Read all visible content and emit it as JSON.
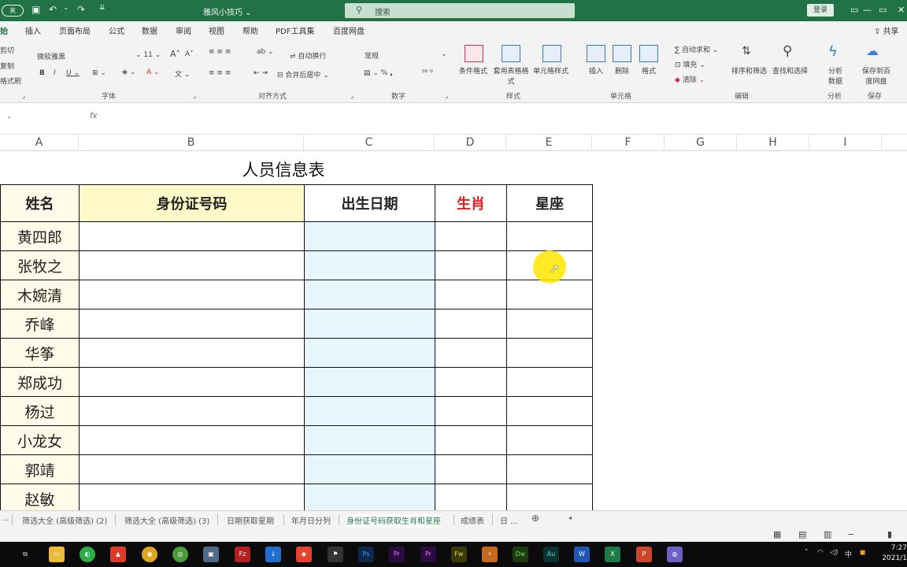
{
  "titlebar": {
    "autosave": "关",
    "title": "雅风小技巧 ⌄",
    "search_placeholder": "搜索",
    "login": "登录",
    "minimize": "—",
    "restore": "▭",
    "close": "✕"
  },
  "tabs": [
    "始",
    "插入",
    "页面布局",
    "公式",
    "数据",
    "审阅",
    "视图",
    "帮助",
    "PDF工具集",
    "百度网盘"
  ],
  "share": "共享",
  "ribbon": {
    "clipboard": [
      "剪切",
      "复制",
      "格式刷"
    ],
    "font_name": "微软雅黑",
    "font_size": "11",
    "font_group": "字体",
    "align_wrap": "自动换行",
    "align_merge": "合并后居中",
    "align_group": "对齐方式",
    "number_format": "常规",
    "number_group": "数字",
    "styles": [
      "条件格式",
      "套用表格格式",
      "单元格样式"
    ],
    "styles_group": "样式",
    "cells": [
      "插入",
      "删除",
      "格式"
    ],
    "cells_group": "单元格",
    "edit": [
      "自动求和",
      "填充",
      "清除"
    ],
    "sort": "排序和筛选",
    "find": "查找和选择",
    "edit_group": "编辑",
    "analyze": "分析数据",
    "analyze_group": "分析",
    "save_baidu": "保存到百度网盘",
    "save_group": "保存"
  },
  "formula_bar": {
    "fx": "fx"
  },
  "columns": [
    "A",
    "B",
    "C",
    "D",
    "E",
    "F",
    "G",
    "H",
    "I"
  ],
  "sheet": {
    "title": "人员信息表",
    "headers": {
      "name": "姓名",
      "id": "身份证号码",
      "birth": "出生日期",
      "zodiac": "生肖",
      "star": "星座"
    },
    "rows": [
      {
        "name": "黄四郎"
      },
      {
        "name": "张牧之"
      },
      {
        "name": "木婉清"
      },
      {
        "name": "乔峰"
      },
      {
        "name": "华筝"
      },
      {
        "name": "郑成功"
      },
      {
        "name": "杨过"
      },
      {
        "name": "小龙女"
      },
      {
        "name": "郭靖"
      },
      {
        "name": "赵敏"
      }
    ],
    "zodiac_color": "#e02020"
  },
  "sheet_tabs": [
    "...",
    "筛选大全 (高级筛选) (2)",
    "筛选大全 (高级筛选) (3)",
    "日期获取星期",
    "年月日分列",
    "身份证号码获取生肖和星座",
    "成绩表",
    "日 ..."
  ],
  "active_sheet_index": 5,
  "taskbar": {
    "apps": [
      "Ps",
      "Pr",
      "Pr",
      "Fw",
      "Dw",
      "Au",
      "W",
      "X",
      "P"
    ],
    "ime": "中",
    "time": "7:27",
    "date": "2021/1"
  },
  "colors": {
    "excel_green": "#217346",
    "header_yellow": "#fff9c9",
    "date_blue": "#e7f5fc",
    "highlight": "#ffe600"
  }
}
